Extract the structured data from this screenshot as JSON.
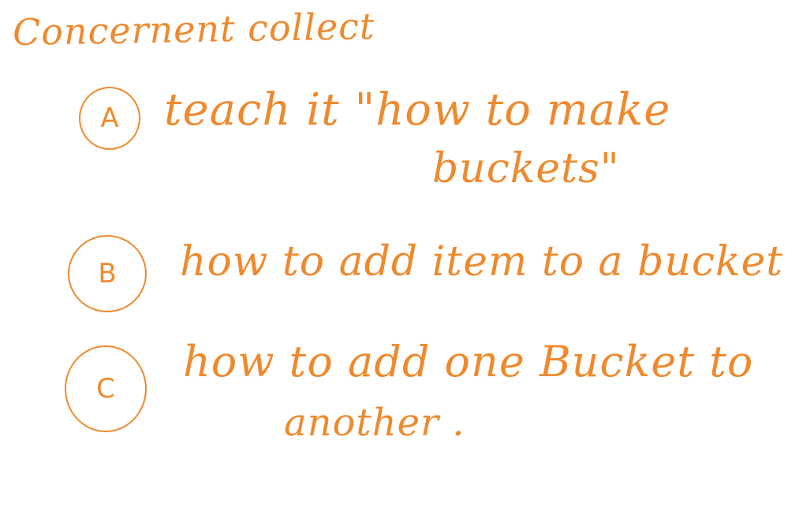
{
  "note": {
    "title": "Concernent collect",
    "items": [
      {
        "marker": "A",
        "line1": "teach it \"how to make",
        "line2": "buckets\""
      },
      {
        "marker": "B",
        "line1": "how to add item to a bucket"
      },
      {
        "marker": "C",
        "line1": "how to add one Bucket to",
        "line2": "another ."
      }
    ],
    "ink_color": "#ee8a2e",
    "background": "#ffffff"
  }
}
